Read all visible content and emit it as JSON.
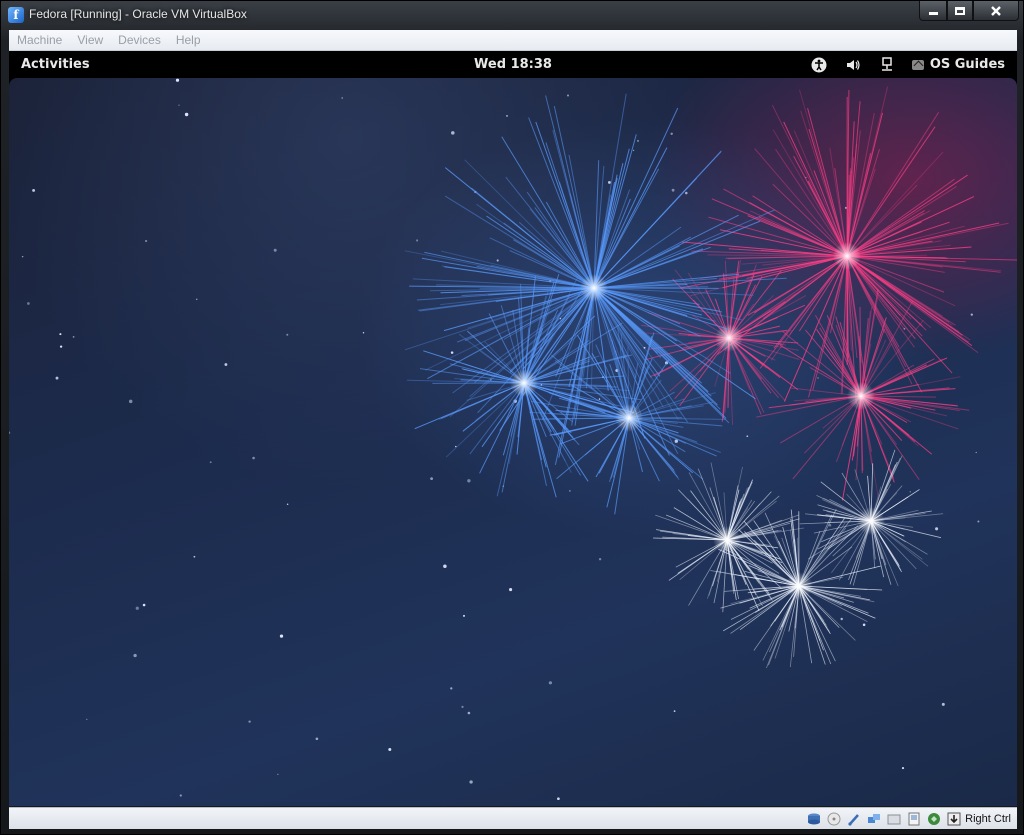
{
  "window": {
    "title": "Fedora [Running] - Oracle VM VirtualBox",
    "icon": "virtualbox-icon"
  },
  "menubar": {
    "items": [
      "Machine",
      "View",
      "Devices",
      "Help"
    ]
  },
  "guest_topbar": {
    "activities": "Activities",
    "clock": "Wed 18:38",
    "tray_icons": [
      "accessibility-icon",
      "volume-icon",
      "network-icon"
    ],
    "extension_label": "OS Guides"
  },
  "statusbar": {
    "icons": [
      "hard-disk-icon",
      "optical-drive-icon",
      "usb-icon",
      "network-adapters-icon",
      "shared-folders-icon",
      "video-capture-icon",
      "guest-additions-icon",
      "keyboard-capture-icon"
    ],
    "host_key": "Right Ctrl"
  },
  "colors": {
    "firework_blue": "#5a9cff",
    "firework_pink": "#ff3f86",
    "firework_white": "#eef3ff"
  }
}
